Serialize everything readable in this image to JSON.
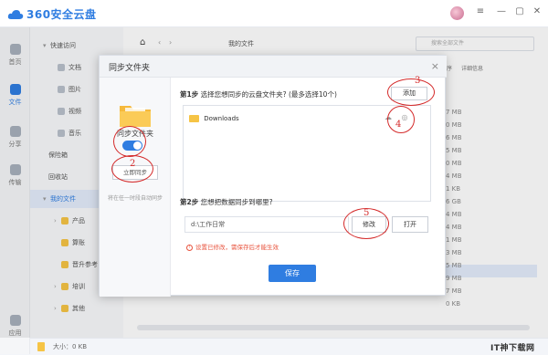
{
  "app": {
    "name": "360安全云盘"
  },
  "rail": [
    {
      "label": "首页",
      "active": false
    },
    {
      "label": "文件",
      "active": true
    },
    {
      "label": "分享",
      "active": false
    },
    {
      "label": "传输",
      "active": false
    },
    {
      "label": "应用",
      "active": false
    }
  ],
  "tree": {
    "quick_access": "快速访问",
    "docs": "文档",
    "pics": "图片",
    "videos": "视频",
    "music": "音乐",
    "vault": "保险箱",
    "recycle": "回收站",
    "my_files": "我的文件",
    "product": "产品",
    "wiki": "算账",
    "reference": "晋升参考",
    "training": "培训",
    "other": "其他"
  },
  "toolbar": {
    "breadcrumb": "我的文件",
    "search_placeholder": "搜索全部文件",
    "sort_label": "文件名排序",
    "details_label": "详细信息"
  },
  "file_sizes": [
    "7 MB",
    "0 MB",
    "6 MB",
    "5 MB",
    "0 MB",
    "4 MB",
    "1 KB",
    "6 GB",
    "4 MB",
    "4 MB",
    "1 MB",
    "3 MB",
    "5 MB",
    "9 MB",
    "7 MB",
    "0 KB"
  ],
  "statusbar": {
    "size_text": "大小：0 KB"
  },
  "watermark": "IT神下载网",
  "dialog": {
    "title": "同步文件夹",
    "close": "×",
    "sync_label": "同步文件夹",
    "instant_button": "立即同步",
    "hint": "将在任一时段自动同步",
    "step1_prefix": "第1步",
    "step1_text": "选择您想同步的云盘文件夹? (最多选择10个)",
    "add_button": "添加",
    "folders": [
      "Downloads"
    ],
    "step2_prefix": "第2步",
    "step2_text": "您想把数据同步到哪里?",
    "local_path": "d:\\工作日常",
    "modify_button": "修改",
    "open_button": "打开",
    "warning": "设置已修改，需保存后才能生效",
    "save_button": "保存"
  },
  "annotations": [
    "2",
    "3",
    "4",
    "5"
  ],
  "colors": {
    "accent": "#2f7de1",
    "annotation": "#d42a2a",
    "folder": "#f6c445"
  }
}
